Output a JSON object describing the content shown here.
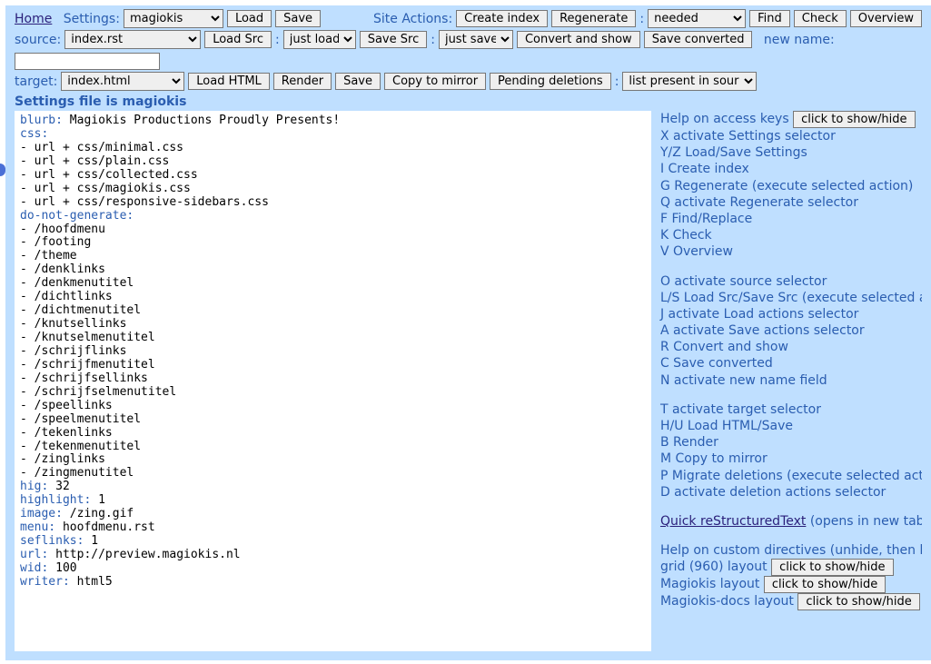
{
  "row1": {
    "home": "Home",
    "settings_label": "Settings:",
    "settings_selected": "magiokis",
    "load": "Load",
    "save": "Save",
    "site_actions_label": "Site Actions:",
    "create_index": "Create index",
    "regenerate": "Regenerate",
    "regen_selected": "needed",
    "find": "Find",
    "check": "Check",
    "overview": "Overview"
  },
  "row2": {
    "source_label": "source:",
    "source_selected": "index.rst",
    "load_src": "Load Src",
    "load_action_selected": "just load",
    "save_src": "Save Src",
    "save_action_selected": "just save",
    "convert_show": "Convert and show",
    "save_converted": "Save converted",
    "new_name_label": "new name:"
  },
  "row3": {
    "target_label": "target:",
    "target_selected": "index.html",
    "load_html": "Load HTML",
    "render": "Render",
    "save": "Save",
    "copy_mirror": "Copy to mirror",
    "pending_del": "Pending deletions",
    "del_action_selected": "list present in source"
  },
  "settings_title": "Settings file is magiokis",
  "yaml": {
    "blurb_k": "blurb:",
    "blurb_v": " Magiokis Productions Proudly Presents!",
    "css_k": "css:",
    "css_items": [
      "- url + css/minimal.css",
      "- url + css/plain.css",
      "- url + css/collected.css",
      "- url + css/magiokis.css",
      "- url + css/responsive-sidebars.css"
    ],
    "dng_k": "do-not-generate:",
    "dng_items": [
      "- /hoofdmenu",
      "- /footing",
      "- /theme",
      "- /denklinks",
      "- /denkmenutitel",
      "- /dichtlinks",
      "- /dichtmenutitel",
      "- /knutsellinks",
      "- /knutselmenutitel",
      "- /schrijflinks",
      "- /schrijfmenutitel",
      "- /schrijfsellinks",
      "- /schrijfselmenutitel",
      "- /speellinks",
      "- /speelmenutitel",
      "- /tekenlinks",
      "- /tekenmenutitel",
      "- /zinglinks",
      "- /zingmenutitel"
    ],
    "hig_k": "hig:",
    "hig_v": " 32",
    "highlight_k": "highlight:",
    "highlight_v": " 1",
    "image_k": "image:",
    "image_v": " /zing.gif",
    "menu_k": "menu:",
    "menu_v": " hoofdmenu.rst",
    "seflinks_k": "seflinks:",
    "seflinks_v": " 1",
    "url_k": "url:",
    "url_v": " http://preview.magiokis.nl",
    "wid_k": "wid:",
    "wid_v": " 100",
    "writer_k": "writer:",
    "writer_v": " html5"
  },
  "help": {
    "access_keys_label": "Help on access keys",
    "toggle": "click to show/hide",
    "lines1": [
      "X activate Settings selector",
      "Y/Z Load/Save Settings",
      "I Create index",
      "G Regenerate (execute selected action)",
      "Q activate Regenerate selector",
      "F Find/Replace",
      "K Check",
      "V Overview"
    ],
    "lines2": [
      "O activate source selector",
      "L/S Load Src/Save Src (execute selected action)",
      "J activate Load actions selector",
      "A activate Save actions selector",
      "R Convert and show",
      "C Save converted",
      "N activate new name field"
    ],
    "lines3": [
      "T activate target selector",
      "H/U Load HTML/Save",
      "B Render",
      "M Copy to mirror",
      "P Migrate deletions (execute selected action)",
      "D activate deletion actions selector"
    ],
    "quickrst": "Quick reStructuredText",
    "quickrst_paren": " (opens in new tab)",
    "custom_dir": "Help on custom directives (unhide, then hover)",
    "grid_label": "grid (960) layout",
    "magiokis_label": "Magiokis layout",
    "magiokis_docs_label": "Magiokis-docs layout"
  }
}
